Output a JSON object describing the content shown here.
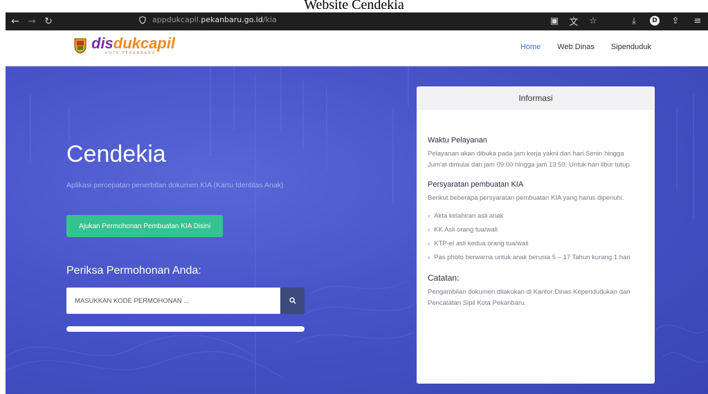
{
  "caption": "Website Cendekia",
  "browser": {
    "url_prefix": "appdukcapil.",
    "url_domain": "pekanbaru.go.id",
    "url_path": "/kia"
  },
  "header": {
    "logo_part1": "dis",
    "logo_part2": "dukcapil",
    "logo_sub": "KOTA PEKANBARU",
    "menu": [
      "Home",
      "Web Dinas",
      "Sipenduduk"
    ]
  },
  "hero": {
    "title": "Cendekia",
    "description": "Aplikasi percepatan penerbitan dokumen KIA (Kartu Identitas Anak)",
    "apply_button": "Ajukan Permohonan Pembuatan KIA Disini",
    "check_title": "Periksa Permohonan Anda:",
    "search_placeholder": "MASUKKAN KODE PERMOHONAN ..."
  },
  "info": {
    "heading": "Informasi",
    "hours_title": "Waktu Pelayanan",
    "hours_text": "Pelayanan akan dibuka pada jam kerja yakni dari hari Senin hingga Jum'at dimulai dari jam 09:00 hingga jam 13:59. Untuk hari libur tutup.",
    "req_title": "Persyaratan pembuatan KIA",
    "req_text": "Berikut beberapa persyaratan pembuatan KIA yang harus dipenuhi.",
    "requirements": [
      "Akta kelahiran asli anak",
      "KK Asli orang tua/wali",
      "KTP-el asli kedua orang tua/wali",
      "Pas photo berwarna untuk anak berusia 5 – 17 Tahun kurang 1 hari"
    ],
    "notes_title": "Catatan:",
    "notes_text": "Pengambilan dokumen dilakukan di Kantor Dinas Kependudukan dan Pencatatan Sipil Kota Pekanbaru."
  },
  "colors": {
    "hero_bg": "#4854c8",
    "apply_button": "#34c38f",
    "search_button": "#3b4a7a",
    "link_active": "#3e6fd6"
  }
}
